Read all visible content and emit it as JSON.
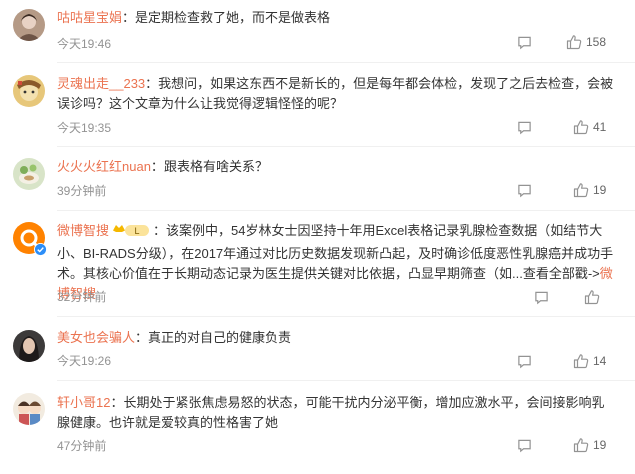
{
  "comments": [
    {
      "user": "咕咕星宝娟",
      "sep": "：",
      "text": "是定期检查救了她，而不是做表格",
      "time": "今天19:46",
      "likes": "158"
    },
    {
      "user": "灵魂出走__233",
      "sep": "：",
      "text": "我想问，如果这东西不是新长的，但是每年都会体检，发现了之后去检查，会被误诊吗？这个文章为什么让我觉得逻辑怪怪的呢？",
      "time": "今天19:35",
      "likes": "41"
    },
    {
      "user": "火火火红红nuan",
      "sep": "：",
      "text": "跟表格有啥关系？",
      "time": "39分钟前",
      "likes": "19"
    },
    {
      "user": "微博智搜",
      "badge_label": "L",
      "sep": "：",
      "text": "该案例中，54岁林女士因坚持十年用Excel表格记录乳腺检查数据（如结节大小、BI-RADS分级），在2017年通过对比历史数据发现新凸起，及时确诊低度恶性乳腺癌并成功手术。其核心价值在于长期动态记录为医生提供关键对比依据，凸显早期筛查（如...",
      "more": "查看全部戳->",
      "more_link": "微博智搜",
      "time": "32分钟前",
      "likes": ""
    },
    {
      "user": "美女也会骗人",
      "sep": "：",
      "text": "真正的对自己的健康负责",
      "time": "今天19:26",
      "likes": "14"
    },
    {
      "user": "轩小哥12",
      "sep": "：",
      "text": "长期处于紧张焦虑易怒的状态，可能干扰内分泌平衡，增加应激水平，会间接影响乳腺健康。也许就是爱较真的性格害了她",
      "time": "47分钟前",
      "likes": "19"
    }
  ],
  "icons": {
    "reply": "comment-icon",
    "like": "thumbs-up-icon"
  },
  "colors": {
    "username": "#eb7350",
    "meta": "#939393",
    "text": "#333333"
  }
}
